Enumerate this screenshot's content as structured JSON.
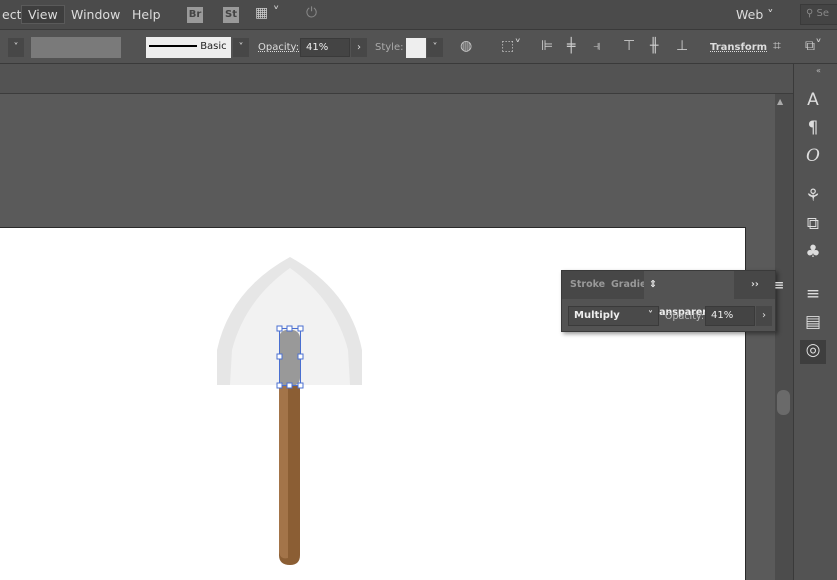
{
  "menubar": {
    "items": [
      "ect",
      "View",
      "Window",
      "Help"
    ],
    "active": "View",
    "bridge": "Br",
    "stock": "St",
    "workspace": "Web",
    "search_placeholder": "Se"
  },
  "control": {
    "stroke_style": "Basic",
    "opacity_label": "Opacity:",
    "opacity_value": "41%",
    "style_label": "Style:",
    "transform_label": "Transform"
  },
  "transparency_panel": {
    "tabs": [
      "Stroke",
      "Gradie",
      "Transparency"
    ],
    "active_tab": "Transparency",
    "blend_mode": "Multiply",
    "opacity_label": "Opacity:",
    "opacity_value": "41%"
  },
  "colors": {
    "handle": "#8b5e34",
    "handle_light": "#a37449",
    "blade_outer": "#e6e6e6",
    "blade_inner": "#f2f2f2",
    "selected": "#999999",
    "selection": "#4a6fd0"
  }
}
